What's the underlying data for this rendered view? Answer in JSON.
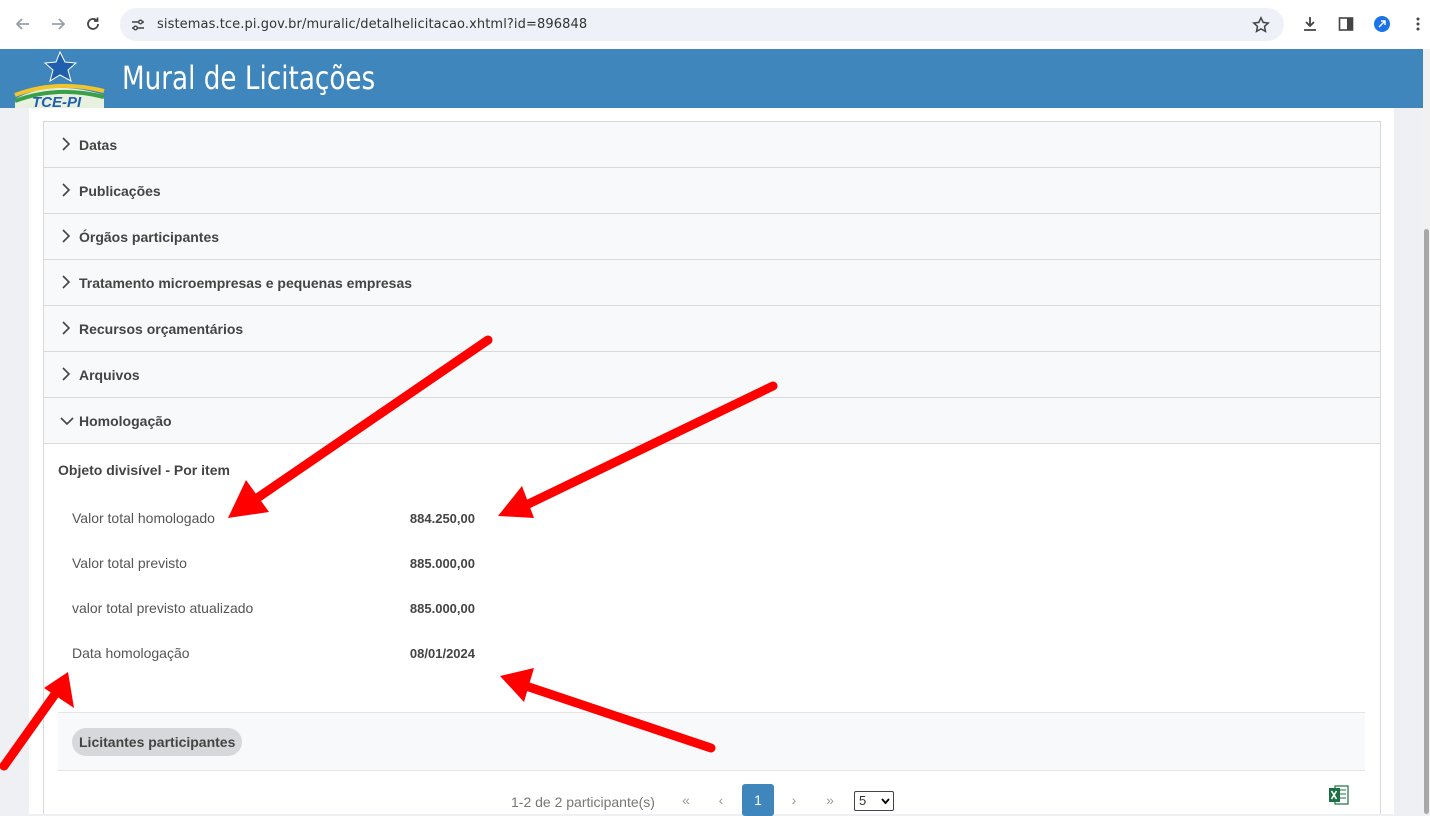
{
  "browser": {
    "url": "sistemas.tce.pi.gov.br/muralic/detalhelicitacao.xhtml?id=896848",
    "icons": [
      "back-icon",
      "forward-icon",
      "reload-icon",
      "site-settings-icon",
      "star-icon",
      "download-icon",
      "sidepanel-icon",
      "extension-icon",
      "menu-dots-icon"
    ]
  },
  "header": {
    "logo_text": "TCE-PI",
    "title": "Mural de Licitações",
    "color": "#3e86bb"
  },
  "accordion": {
    "items": [
      {
        "label": "Datas"
      },
      {
        "label": "Publicações"
      },
      {
        "label": "Órgãos participantes"
      },
      {
        "label": "Tratamento microempresas e pequenas empresas"
      },
      {
        "label": "Recursos orçamentários"
      },
      {
        "label": "Arquivos"
      },
      {
        "label": "Homologação"
      }
    ]
  },
  "homologacao": {
    "object_title": "Objeto divisível - Por item",
    "rows": [
      {
        "label": "Valor total homologado",
        "value": "884.250,00"
      },
      {
        "label": "Valor total previsto",
        "value": "885.000,00"
      },
      {
        "label": "valor total previsto atualizado",
        "value": "885.000,00"
      },
      {
        "label": "Data homologação",
        "value": "08/01/2024"
      }
    ]
  },
  "licitantes": {
    "tab_label": "Licitantes participantes",
    "pager_text": "1-2 de 2 participante(s)",
    "first": "«",
    "prev": "‹",
    "current_page": "1",
    "next": "›",
    "last": "»",
    "per_page": "5"
  },
  "annotation_color": "#ff0000"
}
